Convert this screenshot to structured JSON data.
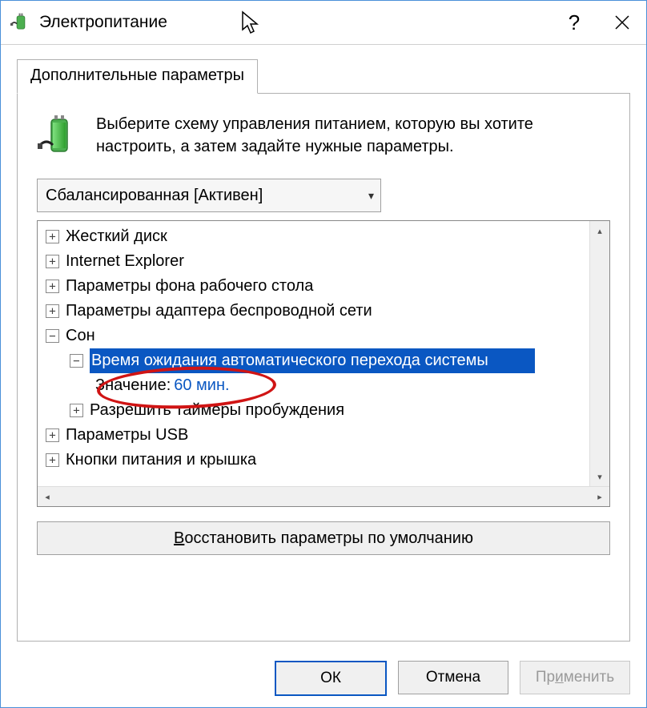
{
  "title": "Электропитание",
  "tab": "Дополнительные параметры",
  "intro": "Выберите схему управления питанием, которую вы хотите настроить, а затем задайте нужные параметры.",
  "scheme_selected": "Сбалансированная [Активен]",
  "tree": {
    "hard_disk": "Жесткий диск",
    "ie": "Internet Explorer",
    "wallpaper": "Параметры фона рабочего стола",
    "wireless": "Параметры адаптера беспроводной сети",
    "sleep": "Сон",
    "sleep_timeout": "Время ожидания автоматического перехода системы",
    "value_label": "Значение:",
    "value_value": "60 мин.",
    "wake_timers": "Разрешить таймеры пробуждения",
    "usb": "Параметры USB",
    "buttons_lid": "Кнопки питания и крышка"
  },
  "restore": "Восстановить параметры по умолчанию",
  "restore_underline_char": "В",
  "buttons": {
    "ok": "ОК",
    "cancel": "Отмена",
    "apply": "Применить"
  }
}
